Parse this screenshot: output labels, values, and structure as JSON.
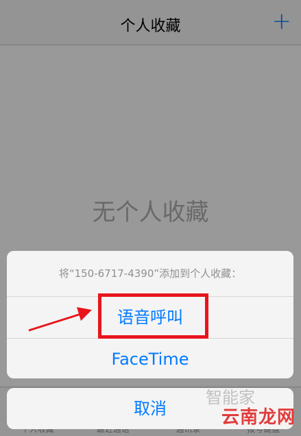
{
  "nav": {
    "title": "个人收藏",
    "add_label": "+"
  },
  "content": {
    "empty_text": "无个人收藏"
  },
  "tabbar": {
    "items": [
      {
        "label": "个人收藏",
        "icon": "★"
      },
      {
        "label": "最近通话",
        "icon": "◷"
      },
      {
        "label": "通讯录",
        "icon": "◉"
      },
      {
        "label": "拨号键盘",
        "icon": "⠿"
      }
    ]
  },
  "sheet": {
    "message": "将“150-6717-4390”添加到个人收藏：",
    "voice_call_label": "语音呼叫",
    "facetime_label": "FaceTime",
    "cancel_label": "取消"
  },
  "watermark": {
    "text": "云南龙网",
    "ghost_text": "智能家"
  },
  "colors": {
    "accent": "#007aff",
    "annotation": "#e8151c"
  }
}
